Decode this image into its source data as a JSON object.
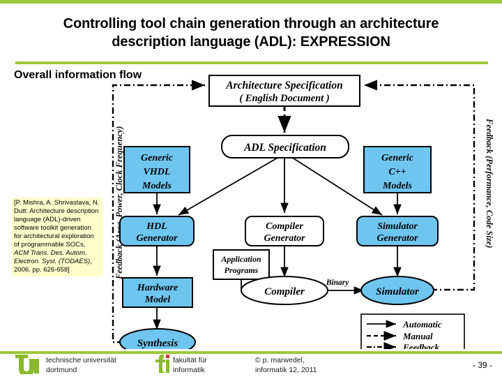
{
  "slide": {
    "title": "Controlling tool chain generation through an architecture description language (ADL): EXPRESSION",
    "title_line1": "Controlling tool chain generation through an architecture",
    "title_line2": "description language (ADL): EXPRESSION",
    "subtitle": "Overall information flow",
    "accent_color": "#9ec83c",
    "node_fill": "#6ec6f0",
    "note_fill": "#ffffcc"
  },
  "citation": {
    "plain_1": "[P. Mishra, A. Shrivastava, N. Dutt: Architecture description language (ADL)-driven software toolkit generation for architectural exploration of programmable SOCs, ",
    "italic_1": "ACM Trans. Des. Autom. Electron. Syst. (TODAES)",
    "plain_2": ", 2006, pp. 626-658]"
  },
  "diagram": {
    "left_feedback_label": "Feedback (Area, Power, Clock Frequency)",
    "right_feedback_label": "Feedback (Performance, Code Size)",
    "nodes": {
      "arch_spec_line1": "Architecture Specification",
      "arch_spec_line2": "( English Document )",
      "adl_spec": "ADL Specification",
      "generic_vhdl_1": "Generic",
      "generic_vhdl_2": "VHDL",
      "generic_vhdl_3": "Models",
      "generic_cpp_1": "Generic",
      "generic_cpp_2": "C++",
      "generic_cpp_3": "Models",
      "hdl_gen_1": "HDL",
      "hdl_gen_2": "Generator",
      "compiler_gen_1": "Compiler",
      "compiler_gen_2": "Generator",
      "simulator_gen_1": "Simulator",
      "simulator_gen_2": "Generator",
      "hardware_model_1": "Hardware",
      "hardware_model_2": "Model",
      "application_programs_1": "Application",
      "application_programs_2": "Programs",
      "compiler": "Compiler",
      "simulator": "Simulator",
      "synthesis": "Synthesis",
      "binary_edge_label": "Binary"
    },
    "legend": {
      "automatic": "Automatic",
      "manual": "Manual",
      "feedback": "Feedback"
    }
  },
  "footer": {
    "tu_line1": "technische universität",
    "tu_line2": "dortmund",
    "fi_line1": "fakultät für",
    "fi_line2": "informatik",
    "copyright_line1": "© p. marwedel,",
    "copyright_line2": "informatik 12,  2011",
    "page_number": "- 39 -"
  }
}
